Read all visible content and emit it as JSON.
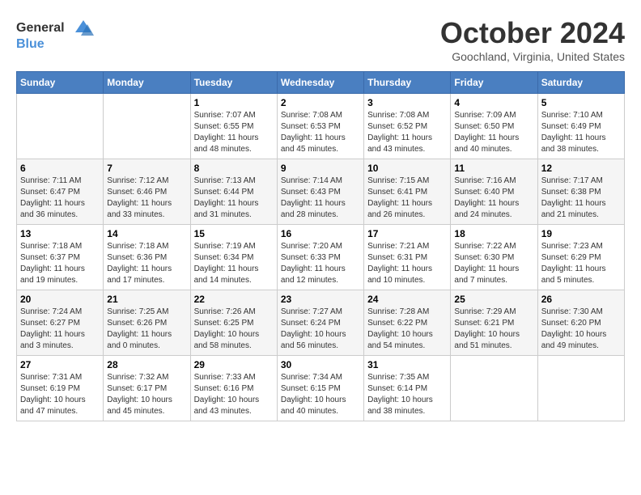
{
  "header": {
    "logo_line1": "General",
    "logo_line2": "Blue",
    "month_title": "October 2024",
    "location": "Goochland, Virginia, United States"
  },
  "weekdays": [
    "Sunday",
    "Monday",
    "Tuesday",
    "Wednesday",
    "Thursday",
    "Friday",
    "Saturday"
  ],
  "weeks": [
    [
      {
        "day": "",
        "sunrise": "",
        "sunset": "",
        "daylight": ""
      },
      {
        "day": "",
        "sunrise": "",
        "sunset": "",
        "daylight": ""
      },
      {
        "day": "1",
        "sunrise": "Sunrise: 7:07 AM",
        "sunset": "Sunset: 6:55 PM",
        "daylight": "Daylight: 11 hours and 48 minutes."
      },
      {
        "day": "2",
        "sunrise": "Sunrise: 7:08 AM",
        "sunset": "Sunset: 6:53 PM",
        "daylight": "Daylight: 11 hours and 45 minutes."
      },
      {
        "day": "3",
        "sunrise": "Sunrise: 7:08 AM",
        "sunset": "Sunset: 6:52 PM",
        "daylight": "Daylight: 11 hours and 43 minutes."
      },
      {
        "day": "4",
        "sunrise": "Sunrise: 7:09 AM",
        "sunset": "Sunset: 6:50 PM",
        "daylight": "Daylight: 11 hours and 40 minutes."
      },
      {
        "day": "5",
        "sunrise": "Sunrise: 7:10 AM",
        "sunset": "Sunset: 6:49 PM",
        "daylight": "Daylight: 11 hours and 38 minutes."
      }
    ],
    [
      {
        "day": "6",
        "sunrise": "Sunrise: 7:11 AM",
        "sunset": "Sunset: 6:47 PM",
        "daylight": "Daylight: 11 hours and 36 minutes."
      },
      {
        "day": "7",
        "sunrise": "Sunrise: 7:12 AM",
        "sunset": "Sunset: 6:46 PM",
        "daylight": "Daylight: 11 hours and 33 minutes."
      },
      {
        "day": "8",
        "sunrise": "Sunrise: 7:13 AM",
        "sunset": "Sunset: 6:44 PM",
        "daylight": "Daylight: 11 hours and 31 minutes."
      },
      {
        "day": "9",
        "sunrise": "Sunrise: 7:14 AM",
        "sunset": "Sunset: 6:43 PM",
        "daylight": "Daylight: 11 hours and 28 minutes."
      },
      {
        "day": "10",
        "sunrise": "Sunrise: 7:15 AM",
        "sunset": "Sunset: 6:41 PM",
        "daylight": "Daylight: 11 hours and 26 minutes."
      },
      {
        "day": "11",
        "sunrise": "Sunrise: 7:16 AM",
        "sunset": "Sunset: 6:40 PM",
        "daylight": "Daylight: 11 hours and 24 minutes."
      },
      {
        "day": "12",
        "sunrise": "Sunrise: 7:17 AM",
        "sunset": "Sunset: 6:38 PM",
        "daylight": "Daylight: 11 hours and 21 minutes."
      }
    ],
    [
      {
        "day": "13",
        "sunrise": "Sunrise: 7:18 AM",
        "sunset": "Sunset: 6:37 PM",
        "daylight": "Daylight: 11 hours and 19 minutes."
      },
      {
        "day": "14",
        "sunrise": "Sunrise: 7:18 AM",
        "sunset": "Sunset: 6:36 PM",
        "daylight": "Daylight: 11 hours and 17 minutes."
      },
      {
        "day": "15",
        "sunrise": "Sunrise: 7:19 AM",
        "sunset": "Sunset: 6:34 PM",
        "daylight": "Daylight: 11 hours and 14 minutes."
      },
      {
        "day": "16",
        "sunrise": "Sunrise: 7:20 AM",
        "sunset": "Sunset: 6:33 PM",
        "daylight": "Daylight: 11 hours and 12 minutes."
      },
      {
        "day": "17",
        "sunrise": "Sunrise: 7:21 AM",
        "sunset": "Sunset: 6:31 PM",
        "daylight": "Daylight: 11 hours and 10 minutes."
      },
      {
        "day": "18",
        "sunrise": "Sunrise: 7:22 AM",
        "sunset": "Sunset: 6:30 PM",
        "daylight": "Daylight: 11 hours and 7 minutes."
      },
      {
        "day": "19",
        "sunrise": "Sunrise: 7:23 AM",
        "sunset": "Sunset: 6:29 PM",
        "daylight": "Daylight: 11 hours and 5 minutes."
      }
    ],
    [
      {
        "day": "20",
        "sunrise": "Sunrise: 7:24 AM",
        "sunset": "Sunset: 6:27 PM",
        "daylight": "Daylight: 11 hours and 3 minutes."
      },
      {
        "day": "21",
        "sunrise": "Sunrise: 7:25 AM",
        "sunset": "Sunset: 6:26 PM",
        "daylight": "Daylight: 11 hours and 0 minutes."
      },
      {
        "day": "22",
        "sunrise": "Sunrise: 7:26 AM",
        "sunset": "Sunset: 6:25 PM",
        "daylight": "Daylight: 10 hours and 58 minutes."
      },
      {
        "day": "23",
        "sunrise": "Sunrise: 7:27 AM",
        "sunset": "Sunset: 6:24 PM",
        "daylight": "Daylight: 10 hours and 56 minutes."
      },
      {
        "day": "24",
        "sunrise": "Sunrise: 7:28 AM",
        "sunset": "Sunset: 6:22 PM",
        "daylight": "Daylight: 10 hours and 54 minutes."
      },
      {
        "day": "25",
        "sunrise": "Sunrise: 7:29 AM",
        "sunset": "Sunset: 6:21 PM",
        "daylight": "Daylight: 10 hours and 51 minutes."
      },
      {
        "day": "26",
        "sunrise": "Sunrise: 7:30 AM",
        "sunset": "Sunset: 6:20 PM",
        "daylight": "Daylight: 10 hours and 49 minutes."
      }
    ],
    [
      {
        "day": "27",
        "sunrise": "Sunrise: 7:31 AM",
        "sunset": "Sunset: 6:19 PM",
        "daylight": "Daylight: 10 hours and 47 minutes."
      },
      {
        "day": "28",
        "sunrise": "Sunrise: 7:32 AM",
        "sunset": "Sunset: 6:17 PM",
        "daylight": "Daylight: 10 hours and 45 minutes."
      },
      {
        "day": "29",
        "sunrise": "Sunrise: 7:33 AM",
        "sunset": "Sunset: 6:16 PM",
        "daylight": "Daylight: 10 hours and 43 minutes."
      },
      {
        "day": "30",
        "sunrise": "Sunrise: 7:34 AM",
        "sunset": "Sunset: 6:15 PM",
        "daylight": "Daylight: 10 hours and 40 minutes."
      },
      {
        "day": "31",
        "sunrise": "Sunrise: 7:35 AM",
        "sunset": "Sunset: 6:14 PM",
        "daylight": "Daylight: 10 hours and 38 minutes."
      },
      {
        "day": "",
        "sunrise": "",
        "sunset": "",
        "daylight": ""
      },
      {
        "day": "",
        "sunrise": "",
        "sunset": "",
        "daylight": ""
      }
    ]
  ]
}
